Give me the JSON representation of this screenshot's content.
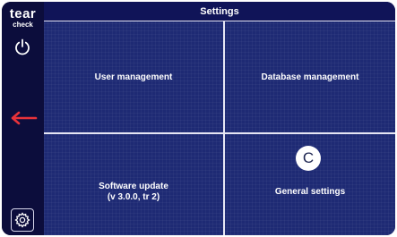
{
  "logo": {
    "line1": "tear",
    "line2": "check"
  },
  "header": {
    "title": "Settings"
  },
  "tiles": {
    "user_management": "User management",
    "database_management": "Database management",
    "software_update": {
      "line1": "Software update",
      "line2": "(v 3.0.0, tr 2)"
    },
    "general_settings": "General settings"
  },
  "badge": {
    "label": "C"
  },
  "icons": {
    "power": "power-icon",
    "back": "back-arrow-icon",
    "settings": "gear-icon"
  },
  "colors": {
    "sidebar": "#0c0d3c",
    "panel": "#1e2a74",
    "titlebar": "#101458",
    "back_arrow": "#e8323a",
    "divider": "#e6e6f4"
  }
}
